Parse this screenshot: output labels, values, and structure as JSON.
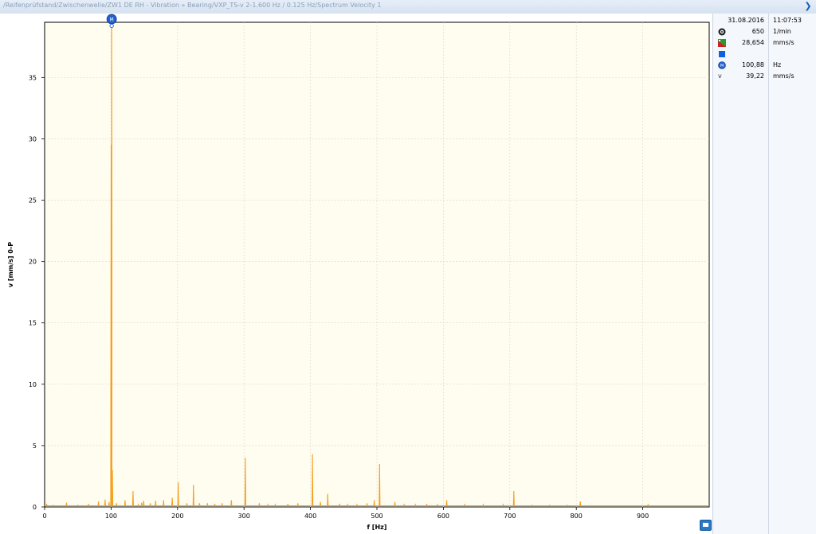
{
  "window": {
    "title": "/Reifenprüfstand/Zwischenwelle/ZW1 DE RH - Vibration » Bearing/VXP_TS-v 2-1.600 Hz / 0.125 Hz/Spectrum Velocity 1"
  },
  "info_panel": {
    "rows": [
      {
        "icon": "calendar-none",
        "value": "31.08.2016",
        "unit": "11:07:53"
      },
      {
        "icon": "speed-icon",
        "value": "650",
        "unit": "1/min"
      },
      {
        "icon": "level-icon",
        "value": "28,654",
        "unit": "mms/s"
      },
      {
        "icon": "blue-square-icon",
        "value": "",
        "unit": ""
      },
      {
        "icon": "marker-icon",
        "value": "100,88",
        "unit": "Hz"
      },
      {
        "icon": "v-icon",
        "value": "39,22",
        "unit": "mms/s"
      }
    ]
  },
  "chart_data": {
    "type": "line",
    "xlabel": "f [Hz]",
    "ylabel": "v [mm/s] 0-P",
    "xlim": [
      0,
      1000
    ],
    "ylim": [
      0,
      39.5
    ],
    "xticks": [
      0,
      100,
      200,
      300,
      400,
      500,
      600,
      700,
      800,
      900
    ],
    "yticks": [
      0,
      5,
      10,
      15,
      20,
      25,
      30,
      35
    ],
    "grid": true,
    "line_color": "#f5a020",
    "plot_background": "#fffdf0",
    "marker": {
      "label": "M",
      "x": 100.88,
      "y": 39.22
    },
    "baseline": 0.1,
    "peaks": [
      {
        "x": 3,
        "y": 0.25
      },
      {
        "x": 13,
        "y": 0.15
      },
      {
        "x": 33,
        "y": 0.35
      },
      {
        "x": 50,
        "y": 0.15
      },
      {
        "x": 66,
        "y": 0.25
      },
      {
        "x": 81,
        "y": 0.45
      },
      {
        "x": 91,
        "y": 0.6
      },
      {
        "x": 97,
        "y": 0.4
      },
      {
        "x": 99.6,
        "y": 10
      },
      {
        "x": 100.1,
        "y": 29.5
      },
      {
        "x": 100.88,
        "y": 39.22
      },
      {
        "x": 101.3,
        "y": 20.6
      },
      {
        "x": 102,
        "y": 3
      },
      {
        "x": 108,
        "y": 0.3
      },
      {
        "x": 121,
        "y": 0.55
      },
      {
        "x": 133,
        "y": 1.3
      },
      {
        "x": 141,
        "y": 0.2
      },
      {
        "x": 146,
        "y": 0.35
      },
      {
        "x": 149,
        "y": 0.5
      },
      {
        "x": 159,
        "y": 0.3
      },
      {
        "x": 167,
        "y": 0.5
      },
      {
        "x": 179,
        "y": 0.55
      },
      {
        "x": 192,
        "y": 0.75
      },
      {
        "x": 201,
        "y": 2.0
      },
      {
        "x": 214,
        "y": 0.3
      },
      {
        "x": 224,
        "y": 1.8
      },
      {
        "x": 233,
        "y": 0.3
      },
      {
        "x": 245,
        "y": 0.3
      },
      {
        "x": 256,
        "y": 0.25
      },
      {
        "x": 267,
        "y": 0.3
      },
      {
        "x": 281,
        "y": 0.55
      },
      {
        "x": 302,
        "y": 4.0
      },
      {
        "x": 323,
        "y": 0.3
      },
      {
        "x": 336,
        "y": 0.2
      },
      {
        "x": 347,
        "y": 0.2
      },
      {
        "x": 366,
        "y": 0.25
      },
      {
        "x": 381,
        "y": 0.3
      },
      {
        "x": 403,
        "y": 4.3
      },
      {
        "x": 415,
        "y": 0.4
      },
      {
        "x": 426,
        "y": 1.05
      },
      {
        "x": 444,
        "y": 0.25
      },
      {
        "x": 456,
        "y": 0.2
      },
      {
        "x": 470,
        "y": 0.2
      },
      {
        "x": 485,
        "y": 0.3
      },
      {
        "x": 496,
        "y": 0.55
      },
      {
        "x": 504,
        "y": 3.5
      },
      {
        "x": 527,
        "y": 0.4
      },
      {
        "x": 541,
        "y": 0.2
      },
      {
        "x": 558,
        "y": 0.2
      },
      {
        "x": 575,
        "y": 0.25
      },
      {
        "x": 591,
        "y": 0.2
      },
      {
        "x": 605,
        "y": 0.55
      },
      {
        "x": 632,
        "y": 0.2
      },
      {
        "x": 660,
        "y": 0.2
      },
      {
        "x": 690,
        "y": 0.2
      },
      {
        "x": 706,
        "y": 1.3
      },
      {
        "x": 733,
        "y": 0.15
      },
      {
        "x": 760,
        "y": 0.15
      },
      {
        "x": 786,
        "y": 0.15
      },
      {
        "x": 806,
        "y": 0.45
      },
      {
        "x": 835,
        "y": 0.1
      },
      {
        "x": 865,
        "y": 0.1
      },
      {
        "x": 908,
        "y": 0.2
      }
    ]
  }
}
